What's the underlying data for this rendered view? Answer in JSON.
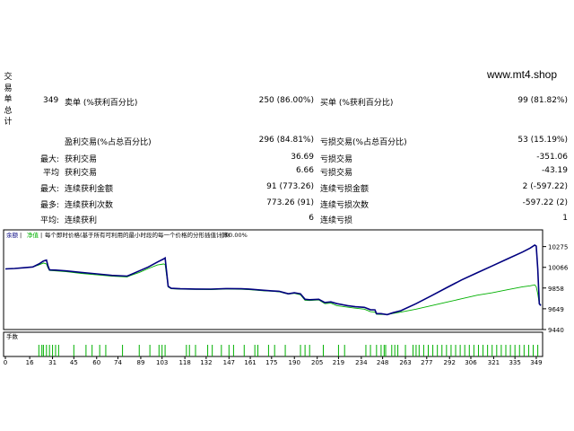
{
  "site": "www.mt4.shop",
  "side_label": [
    "交",
    "易",
    "单",
    "总",
    "计"
  ],
  "stats": {
    "total": "349",
    "sell_label": "卖单 (%获利百分比)",
    "sell_val": "250 (86.00%)",
    "buy_label": "买单 (%获利百分比)",
    "buy_val": "99 (81.82%)",
    "win_label": "盈利交易(%占总百分比)",
    "win_val": "296 (84.81%)",
    "loss_label": "亏损交易(%占总百分比)",
    "loss_val": "53 (15.19%)",
    "rows": [
      {
        "pre": "最大:",
        "l1": "获利交易",
        "v1": "36.69",
        "l2": "亏损交易",
        "v2": "-351.06"
      },
      {
        "pre": "平均",
        "l1": "获利交易",
        "v1": "6.66",
        "l2": "亏损交易",
        "v2": "-43.19"
      },
      {
        "pre": "最大:",
        "l1": "连续获利金额",
        "v1": "91 (773.26)",
        "l2": "连续亏损金额",
        "v2": "2 (-597.22)"
      },
      {
        "pre": "最多:",
        "l1": "连续获利次数",
        "v1": "773.26 (91)",
        "l2": "连续亏损次数",
        "v2": "-597.22 (2)"
      },
      {
        "pre": "平均:",
        "l1": "连续获利",
        "v1": "6",
        "l2": "连续亏损",
        "v2": "1"
      }
    ]
  },
  "chart_header": {
    "balance": "余额",
    "equity": "净值",
    "desc": "每个即时价格(基于所有可利用的最小时段的每一个价格的分形插值计算)",
    "quality": "90.00%"
  },
  "volume_label": "手数",
  "colors": {
    "balance": "#00007f",
    "equity": "#00b000",
    "volume": "#00b000"
  },
  "chart_data": {
    "type": "line",
    "ylim": [
      9440,
      10380
    ],
    "y_ticks": [
      10275,
      10066,
      9858,
      9649,
      9440
    ],
    "x_ticks": [
      0,
      16,
      31,
      45,
      60,
      74,
      89,
      103,
      118,
      132,
      147,
      161,
      175,
      190,
      205,
      219,
      234,
      248,
      263,
      277,
      292,
      306,
      321,
      335,
      349
    ],
    "xlim": [
      0,
      352
    ],
    "series": [
      {
        "name": "余额",
        "points": [
          [
            0,
            10050
          ],
          [
            6,
            10055
          ],
          [
            12,
            10062
          ],
          [
            18,
            10070
          ],
          [
            22,
            10100
          ],
          [
            25,
            10130
          ],
          [
            27,
            10140
          ],
          [
            28,
            10080
          ],
          [
            29,
            10040
          ],
          [
            33,
            10038
          ],
          [
            40,
            10030
          ],
          [
            50,
            10015
          ],
          [
            60,
            10000
          ],
          [
            70,
            9985
          ],
          [
            80,
            9978
          ],
          [
            82,
            9990
          ],
          [
            88,
            10030
          ],
          [
            94,
            10070
          ],
          [
            100,
            10120
          ],
          [
            104,
            10150
          ],
          [
            105,
            10160
          ],
          [
            107,
            9875
          ],
          [
            109,
            9855
          ],
          [
            115,
            9850
          ],
          [
            125,
            9848
          ],
          [
            135,
            9847
          ],
          [
            145,
            9852
          ],
          [
            155,
            9850
          ],
          [
            160,
            9848
          ],
          [
            170,
            9835
          ],
          [
            175,
            9830
          ],
          [
            180,
            9825
          ],
          [
            183,
            9812
          ],
          [
            186,
            9800
          ],
          [
            190,
            9810
          ],
          [
            194,
            9800
          ],
          [
            197,
            9745
          ],
          [
            200,
            9740
          ],
          [
            206,
            9745
          ],
          [
            210,
            9712
          ],
          [
            214,
            9718
          ],
          [
            218,
            9700
          ],
          [
            225,
            9680
          ],
          [
            230,
            9670
          ],
          [
            236,
            9663
          ],
          [
            240,
            9640
          ],
          [
            243,
            9638
          ],
          [
            244,
            9600
          ],
          [
            247,
            9600
          ],
          [
            251,
            9590
          ],
          [
            255,
            9610
          ],
          [
            260,
            9630
          ],
          [
            270,
            9700
          ],
          [
            280,
            9780
          ],
          [
            290,
            9860
          ],
          [
            300,
            9940
          ],
          [
            310,
            10010
          ],
          [
            320,
            10080
          ],
          [
            330,
            10150
          ],
          [
            340,
            10220
          ],
          [
            345,
            10260
          ],
          [
            348,
            10290
          ],
          [
            349,
            10280
          ],
          [
            350,
            10050
          ],
          [
            351,
            9700
          ],
          [
            352,
            9680
          ]
        ]
      },
      {
        "name": "净值",
        "points": [
          [
            0,
            10050
          ],
          [
            6,
            10055
          ],
          [
            12,
            10062
          ],
          [
            18,
            10070
          ],
          [
            22,
            10090
          ],
          [
            25,
            10110
          ],
          [
            27,
            10100
          ],
          [
            28,
            10060
          ],
          [
            29,
            10035
          ],
          [
            33,
            10030
          ],
          [
            40,
            10022
          ],
          [
            50,
            10005
          ],
          [
            60,
            9990
          ],
          [
            70,
            9978
          ],
          [
            80,
            9970
          ],
          [
            82,
            9982
          ],
          [
            88,
            10015
          ],
          [
            94,
            10055
          ],
          [
            100,
            10090
          ],
          [
            104,
            10100
          ],
          [
            105,
            10095
          ],
          [
            107,
            9868
          ],
          [
            109,
            9850
          ],
          [
            115,
            9846
          ],
          [
            125,
            9844
          ],
          [
            135,
            9842
          ],
          [
            145,
            9848
          ],
          [
            155,
            9845
          ],
          [
            160,
            9842
          ],
          [
            170,
            9830
          ],
          [
            175,
            9826
          ],
          [
            180,
            9820
          ],
          [
            183,
            9808
          ],
          [
            186,
            9796
          ],
          [
            190,
            9804
          ],
          [
            194,
            9790
          ],
          [
            197,
            9735
          ],
          [
            200,
            9732
          ],
          [
            206,
            9738
          ],
          [
            210,
            9700
          ],
          [
            214,
            9706
          ],
          [
            218,
            9680
          ],
          [
            225,
            9665
          ],
          [
            230,
            9655
          ],
          [
            236,
            9645
          ],
          [
            240,
            9620
          ],
          [
            243,
            9615
          ],
          [
            244,
            9595
          ],
          [
            247,
            9592
          ],
          [
            251,
            9592
          ],
          [
            255,
            9602
          ],
          [
            260,
            9615
          ],
          [
            270,
            9645
          ],
          [
            280,
            9680
          ],
          [
            290,
            9715
          ],
          [
            300,
            9750
          ],
          [
            310,
            9785
          ],
          [
            320,
            9810
          ],
          [
            330,
            9840
          ],
          [
            340,
            9870
          ],
          [
            345,
            9880
          ],
          [
            348,
            9890
          ],
          [
            349,
            9870
          ],
          [
            350,
            9800
          ],
          [
            351,
            9700
          ],
          [
            352,
            9690
          ]
        ]
      }
    ],
    "volume_bars": [
      22,
      24,
      25,
      27,
      29,
      31,
      33,
      35,
      45,
      53,
      57,
      62,
      66,
      77,
      88,
      95,
      101,
      103,
      105,
      119,
      121,
      125,
      133,
      136,
      142,
      147,
      150,
      157,
      164,
      166,
      173,
      177,
      184,
      194,
      197,
      200,
      209,
      219,
      223,
      237,
      240,
      244,
      247,
      249,
      250,
      254,
      256,
      258,
      263,
      268,
      270,
      272,
      275,
      278,
      281,
      284,
      287,
      290,
      293,
      296,
      299,
      302,
      305,
      308,
      311,
      314,
      317,
      320,
      323,
      326,
      329,
      332,
      335,
      338,
      341,
      344,
      347,
      350
    ]
  }
}
